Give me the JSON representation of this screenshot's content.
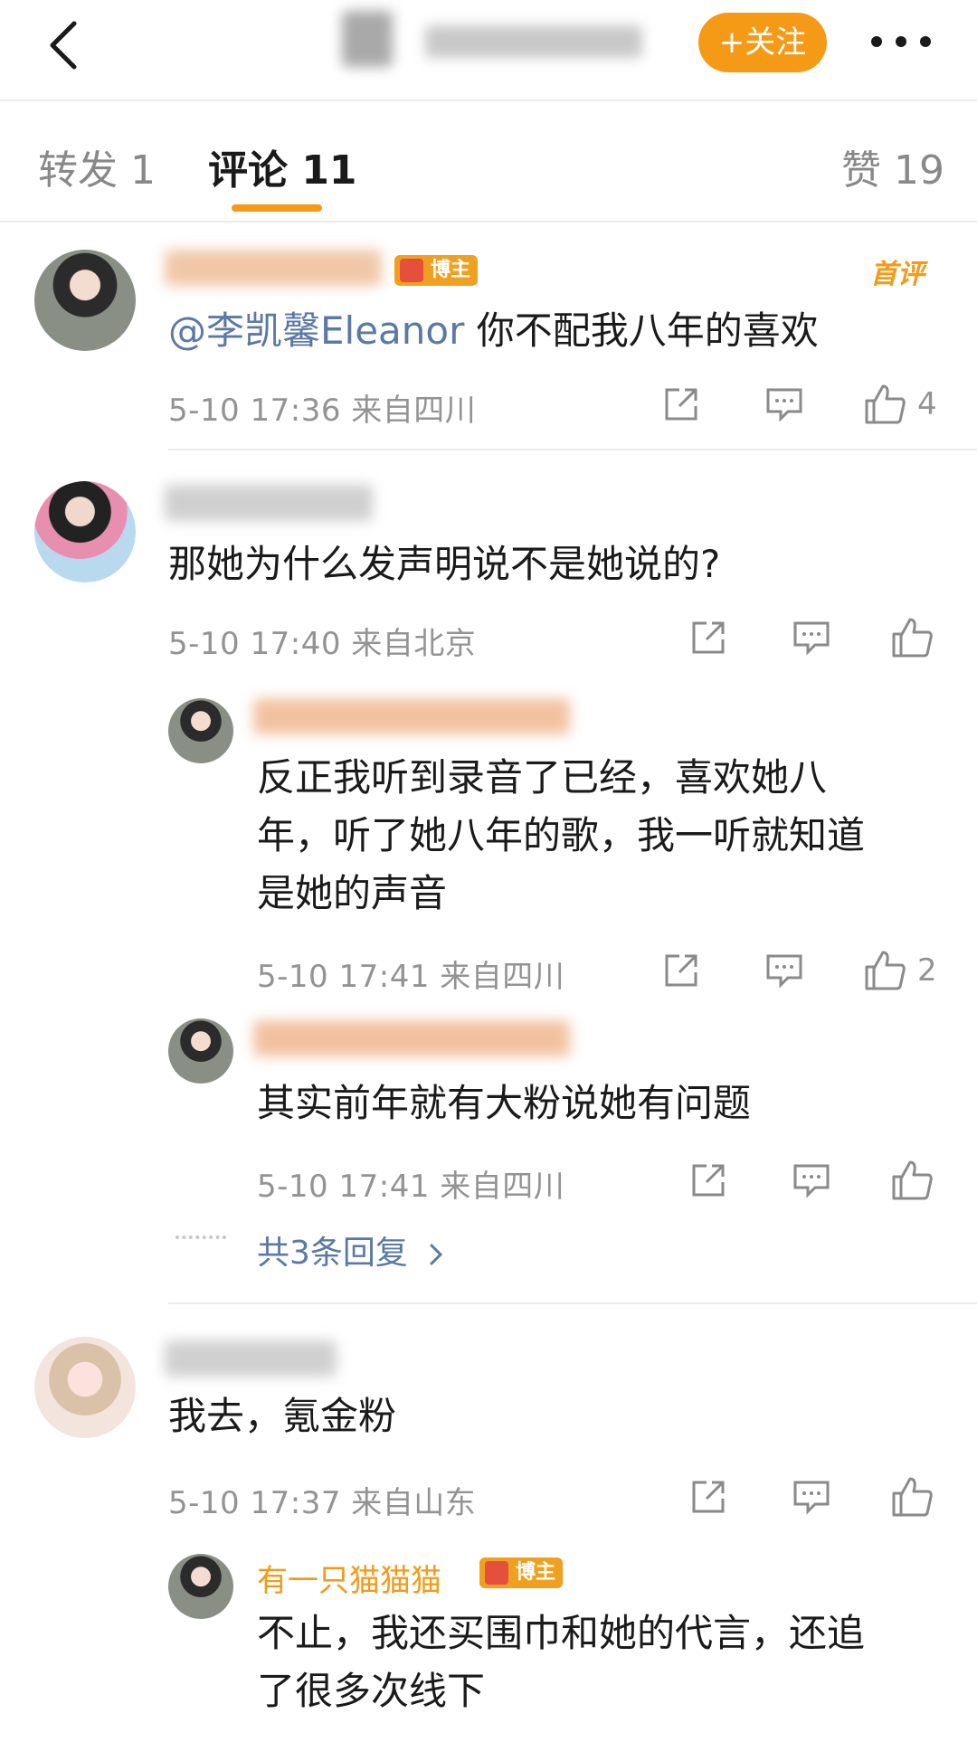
{
  "header": {
    "follow_label": "+关注"
  },
  "tabs": {
    "repost": "转发 1",
    "comment": "评论 11",
    "likes": "赞 19"
  },
  "comments": [
    {
      "first_tag": "首评",
      "badge": "博主",
      "mention": "@李凯馨Eleanor",
      "text": " 你不配我八年的喜欢",
      "meta": "5-10 17:36 来自四川",
      "likes": "4"
    },
    {
      "text": "那她为什么发声明说不是她说的?",
      "meta": "5-10 17:40 来自北京",
      "replies": [
        {
          "lines": [
            "反正我听到录音了已经，喜欢她八",
            "年，听了她八年的歌，我一听就知道",
            "是她的声音"
          ],
          "meta": "5-10 17:41 来自四川",
          "likes": "2"
        },
        {
          "lines": [
            "其实前年就有大粉说她有问题"
          ],
          "meta": "5-10 17:41 来自四川"
        }
      ],
      "more_replies": "共3条回复"
    },
    {
      "text": "我去，氪金粉",
      "meta": "5-10 17:37 来自山东",
      "replies": [
        {
          "username": "有一只猫猫猫",
          "badge": "博主",
          "lines": [
            "不止，我还买围巾和她的代言，还追",
            "了很多次线下"
          ]
        }
      ]
    }
  ],
  "colors": {
    "accent": "#f59a16",
    "mention": "#5b78a6",
    "meta": "#939393"
  }
}
